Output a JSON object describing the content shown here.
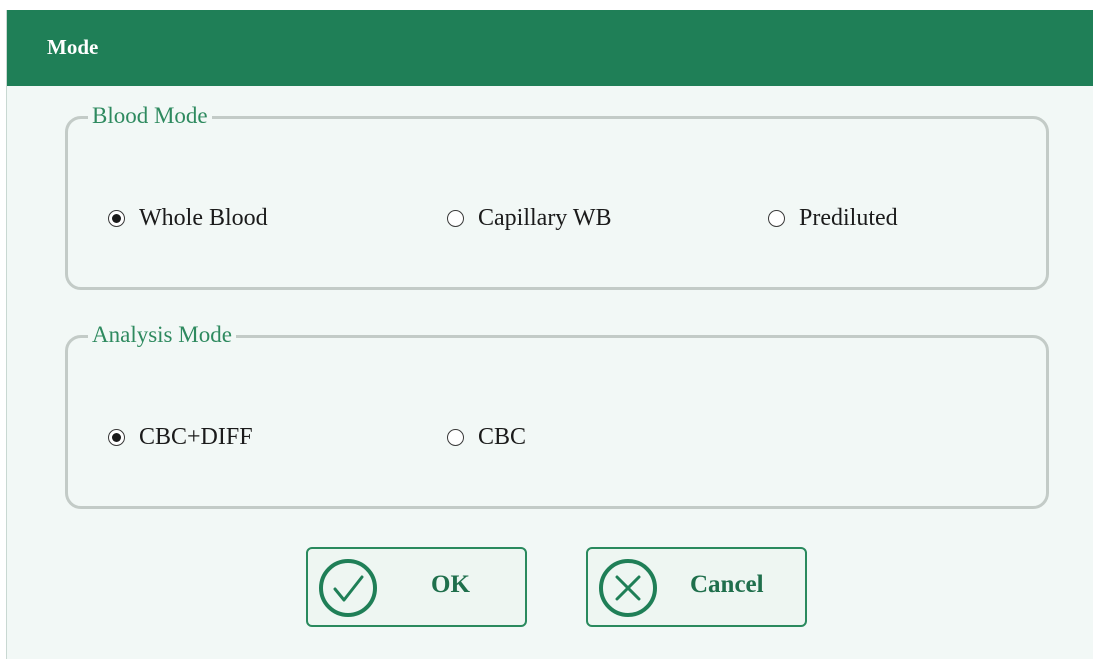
{
  "dialog": {
    "title": "Mode"
  },
  "blood_mode": {
    "legend": "Blood Mode",
    "options": [
      {
        "label": "Whole Blood",
        "selected": true
      },
      {
        "label": "Capillary WB",
        "selected": false
      },
      {
        "label": "Prediluted",
        "selected": false
      }
    ]
  },
  "analysis_mode": {
    "legend": "Analysis Mode",
    "options": [
      {
        "label": "CBC+DIFF",
        "selected": true
      },
      {
        "label": "CBC",
        "selected": false
      }
    ]
  },
  "buttons": {
    "ok_label": "OK",
    "ok_icon": "check-circle-icon",
    "cancel_label": "Cancel",
    "cancel_icon": "x-circle-icon"
  },
  "colors": {
    "titlebar": "#1f7f57",
    "accent_text": "#2e8a5f",
    "background": "#f2f8f6"
  }
}
